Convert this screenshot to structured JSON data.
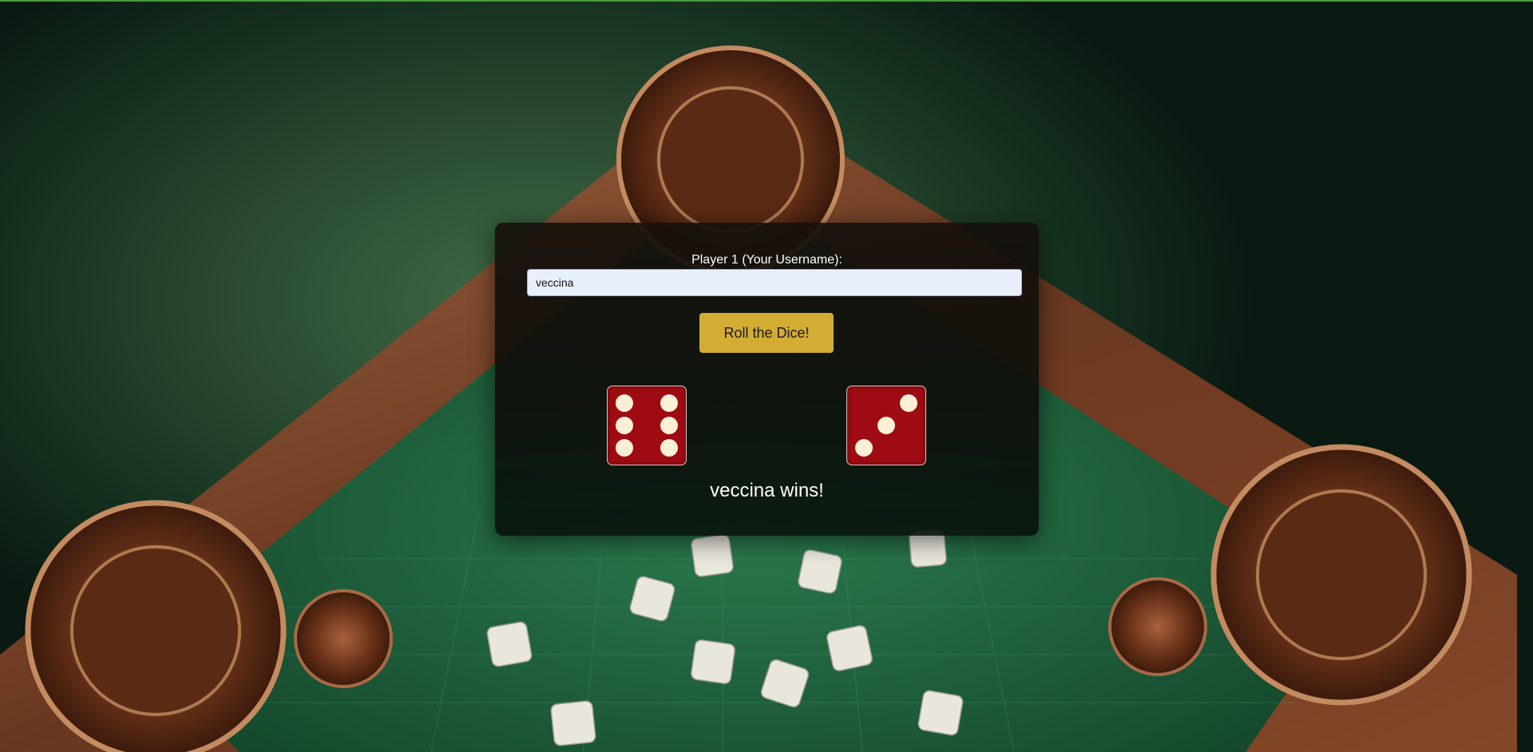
{
  "player": {
    "label": "Player 1 (Your Username):",
    "username_value": "veccina",
    "placeholder": ""
  },
  "roll_button_label": "Roll the Dice!",
  "dice": {
    "die1_value": 6,
    "die2_value": 3,
    "color": "#9e0b12",
    "pip_color": "#fbf0d6"
  },
  "result_text": "veccina wins!",
  "colors": {
    "button": "#d3ac34",
    "input_bg": "#e8f0fe",
    "table_felt": "#1f5c3a",
    "wood": "#7a3f24",
    "accent_top_line": "#4c9a3c"
  }
}
